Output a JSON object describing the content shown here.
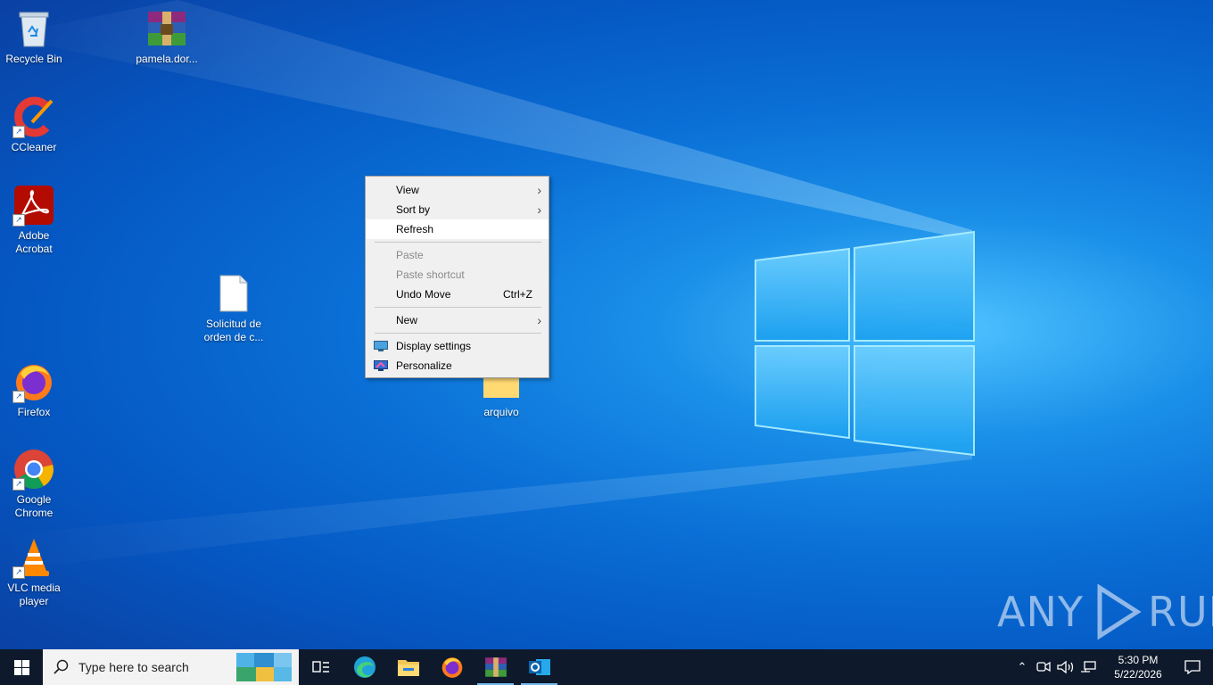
{
  "desktop": {
    "icons": [
      {
        "label": "Recycle Bin"
      },
      {
        "label": "pamela.dor..."
      },
      {
        "label": "CCleaner"
      },
      {
        "label": "Adobe Acrobat"
      },
      {
        "label": "Solicitud de orden de c..."
      },
      {
        "label": "Firefox"
      },
      {
        "label": "Google Chrome"
      },
      {
        "label": "VLC media player"
      },
      {
        "label": "arquivo"
      }
    ]
  },
  "context_menu": {
    "items": [
      {
        "label": "View",
        "submenu": true
      },
      {
        "label": "Sort by",
        "submenu": true
      },
      {
        "label": "Refresh",
        "highlighted": true
      },
      {
        "label": "Paste",
        "disabled": true
      },
      {
        "label": "Paste shortcut",
        "disabled": true
      },
      {
        "label": "Undo Move",
        "shortcut": "Ctrl+Z"
      },
      {
        "label": "New",
        "submenu": true
      },
      {
        "label": "Display settings",
        "icon": "display-settings-icon"
      },
      {
        "label": "Personalize",
        "icon": "personalize-icon"
      }
    ]
  },
  "taskbar": {
    "search_placeholder": "Type here to search",
    "apps": [
      "task-view",
      "edge",
      "file-explorer",
      "firefox",
      "winrar",
      "outlook"
    ],
    "clock": {
      "time": "5:30 PM",
      "date": "5/22/2026"
    }
  },
  "watermark": {
    "left": "ANY",
    "right": "RUN"
  },
  "colors": {
    "desktop_blue": "#0a6fd6",
    "taskbar": "#0e1a2b",
    "menu_bg": "#f0f0f0"
  }
}
